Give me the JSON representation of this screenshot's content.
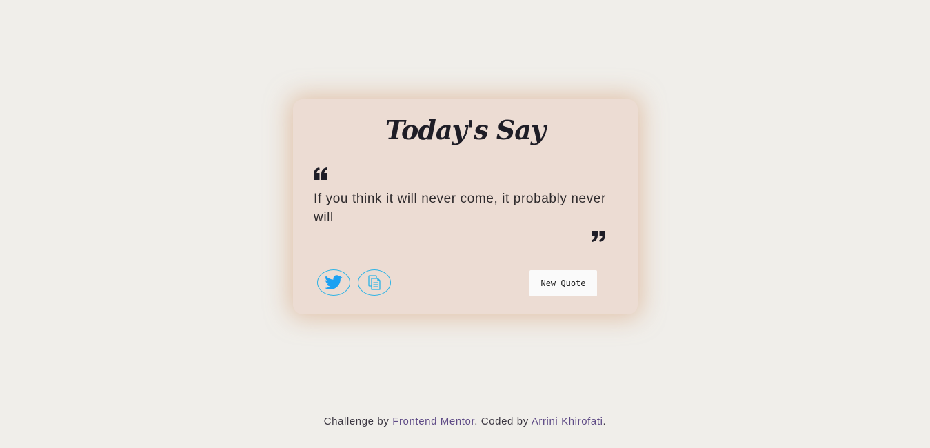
{
  "card": {
    "title": "Today's Say",
    "quote": "If you think it will never come, it probably never will",
    "new_quote_label": "New Quote",
    "share_icon": "twitter-icon",
    "copy_icon": "copy-icon"
  },
  "footer": {
    "prefix": "Challenge by ",
    "challenge_link": "Frontend Mentor",
    "middle": ". Coded by ",
    "author_link": "Arrini Khirofati",
    "suffix": "."
  },
  "colors": {
    "background": "#f0eeea",
    "card": "#ecdcd3",
    "accent": "#2bb3e6",
    "link": "#5e4a86",
    "text": "#1e1d26"
  }
}
